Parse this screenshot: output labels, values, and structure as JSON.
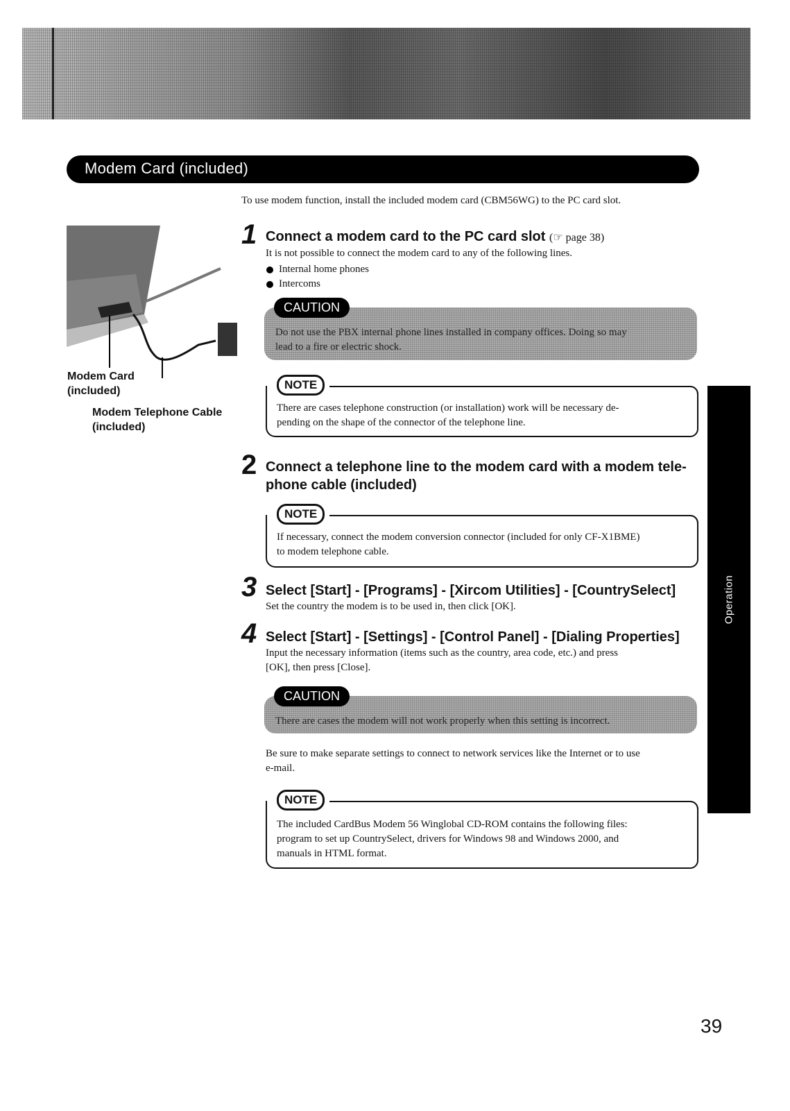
{
  "section_title": "Modem Card (included)",
  "intro": "To use modem function, install the included modem card (CBM56WG) to the PC card slot.",
  "illustration": {
    "icon": "laptop-modem-illustration",
    "label_card": [
      "Modem Card",
      "(included)"
    ],
    "label_cable": [
      "Modem Telephone Cable",
      "(included)"
    ]
  },
  "steps": [
    {
      "number": "1",
      "title": "Connect a modem card to the PC card slot",
      "ref_icon": "hand-pointer-icon",
      "ref": "page 38",
      "text": "It is not possible to connect the modem card to any of the following lines.",
      "bullets": [
        "Internal home phones",
        "Intercoms"
      ]
    },
    {
      "number": "2",
      "title_line1": "Connect a telephone line to the modem card with a modem tele-",
      "title_line2": "phone cable (included)"
    },
    {
      "number": "3",
      "title": "Select [Start] - [Programs] - [Xircom Utilities] - [CountrySelect]",
      "text": "Set the country the modem is to be used in, then click [OK]."
    },
    {
      "number": "4",
      "title": "Select [Start] - [Settings] - [Control Panel] - [Dialing Properties]",
      "text_line1": "Input the necessary information (items such as the country, area code, etc.) and press",
      "text_line2": "[OK], then press [Close]."
    }
  ],
  "cautions": [
    {
      "label": "CAUTION",
      "line1": "Do not use the PBX internal phone lines installed in company offices. Doing so may",
      "line2": "lead to a fire or electric shock."
    },
    {
      "label": "CAUTION",
      "line1": "There are cases the modem will not work properly when this setting is incorrect."
    }
  ],
  "notes": [
    {
      "label": "NOTE",
      "line1": "There are cases telephone construction (or installation) work will be necessary de-",
      "line2": "pending on the shape of the connector of the telephone line."
    },
    {
      "label": "NOTE",
      "line1": "If necessary, connect the modem conversion connector (included for only CF-X1BME)",
      "line2": "to modem telephone cable."
    },
    {
      "label": "NOTE",
      "line1": "The included CardBus Modem 56  Winglobal CD-ROM contains the following files:",
      "line2": "program to set up CountrySelect, drivers for Windows 98 and Windows 2000, and",
      "line3": "manuals in HTML format."
    }
  ],
  "after_caution_text_line1": "Be sure to make separate settings to connect to network services like the Internet or to use",
  "after_caution_text_line2": "e-mail.",
  "side_tab": "Operation",
  "page_number": "39"
}
